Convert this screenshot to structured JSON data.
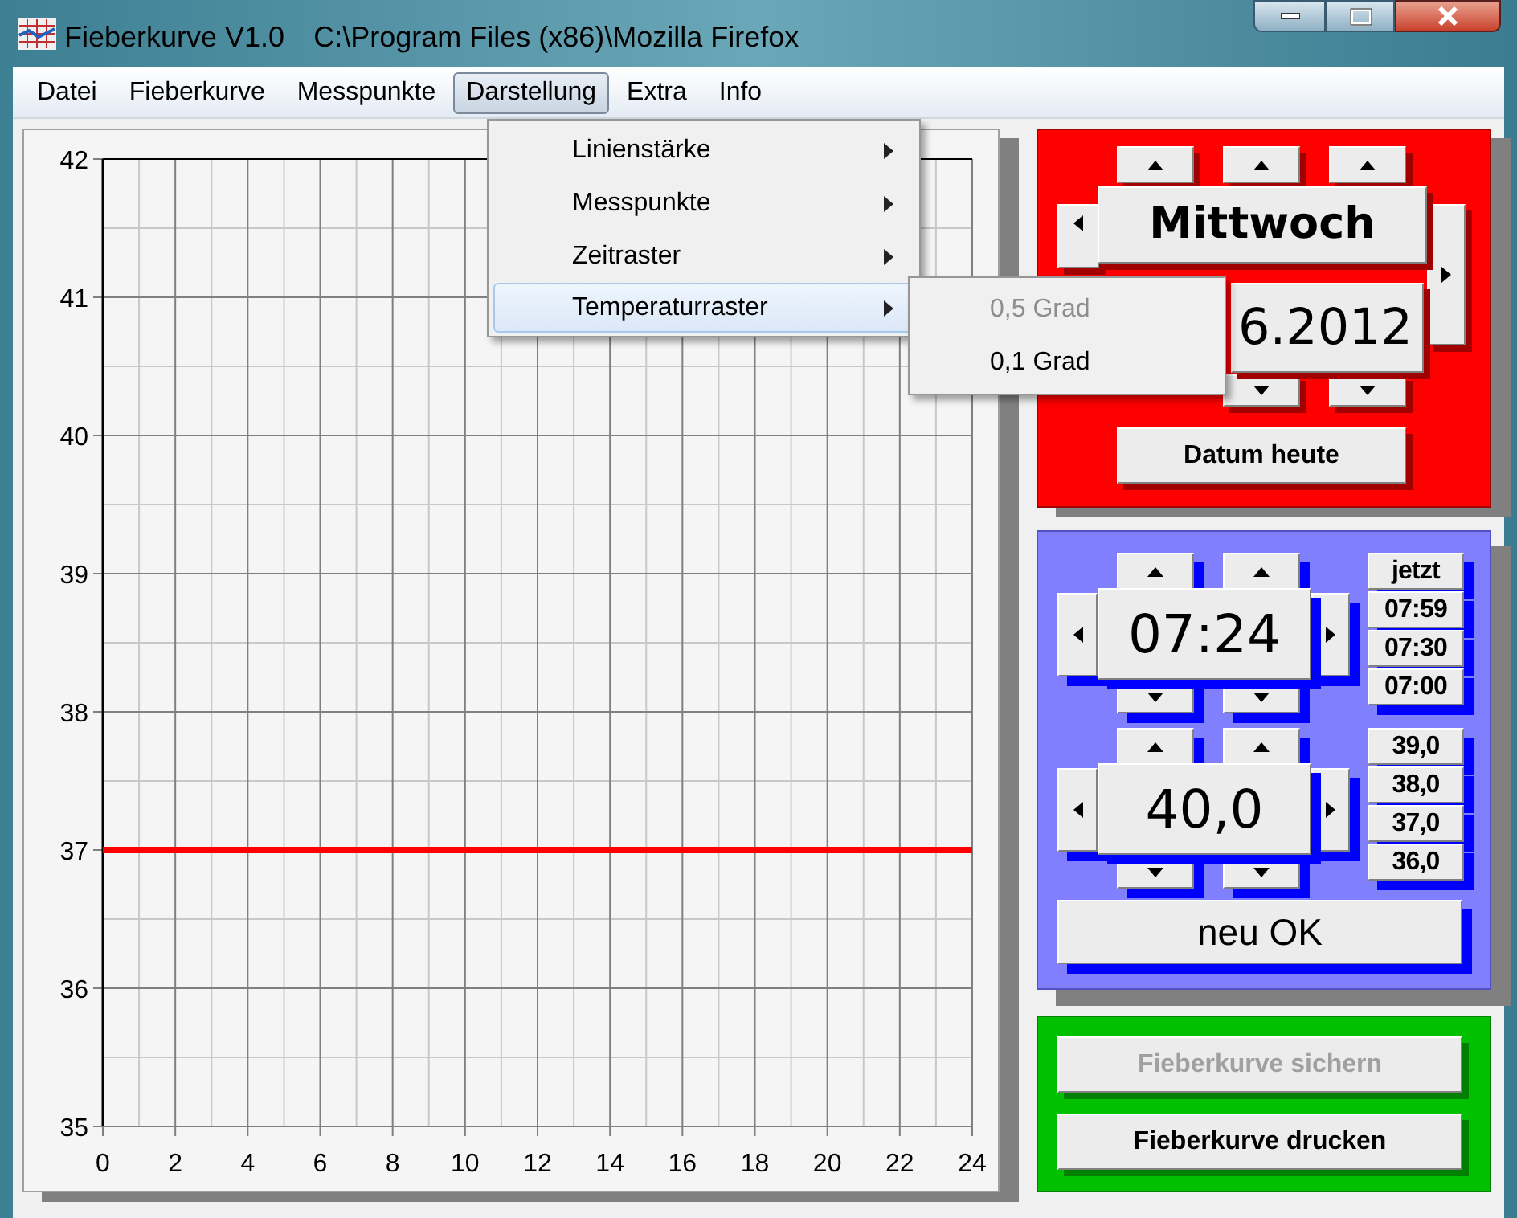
{
  "window": {
    "title": "Fieberkurve V1.0",
    "path": "C:\\Program Files (x86)\\Mozilla Firefox"
  },
  "menu": [
    {
      "label": "Datei",
      "selected": false
    },
    {
      "label": "Fieberkurve",
      "selected": false
    },
    {
      "label": "Messpunkte",
      "selected": false
    },
    {
      "label": "Darstellung",
      "selected": true
    },
    {
      "label": "Extra",
      "selected": false
    },
    {
      "label": "Info",
      "selected": false
    }
  ],
  "dropdown": [
    {
      "label": "Linienstärke",
      "selected": false
    },
    {
      "label": "Messpunkte",
      "selected": false
    },
    {
      "label": "Zeitraster",
      "selected": false
    },
    {
      "label": "Temperaturraster",
      "selected": true
    }
  ],
  "submenu": [
    {
      "label": "0,5 Grad",
      "disabled": true
    },
    {
      "label": "0,1 Grad",
      "disabled": false
    }
  ],
  "chart": {
    "chart_data": {
      "type": "line",
      "grid": true,
      "x": [
        0,
        24
      ],
      "xlim": [
        0,
        24
      ],
      "ylim": [
        35,
        42
      ],
      "xticks": [
        0,
        2,
        4,
        6,
        8,
        10,
        12,
        14,
        16,
        18,
        20,
        22,
        24
      ],
      "yticks": [
        35,
        36,
        37,
        38,
        39,
        40,
        41,
        42
      ],
      "series": [
        {
          "color": "#ff0000",
          "values": [
            37,
            37
          ]
        }
      ]
    }
  },
  "date_panel": {
    "weekday": "Mittwoch",
    "date": "6.2012",
    "today_button": "Datum heute"
  },
  "time": {
    "value": "07:24",
    "presets": [
      "jetzt",
      "07:59",
      "07:30",
      "07:00"
    ]
  },
  "temperature": {
    "value": "40,0",
    "presets": [
      "39,0",
      "38,0",
      "37,0",
      "36,0"
    ]
  },
  "confirm_button": "neu OK",
  "actions": [
    {
      "label": "Fieberkurve sichern",
      "disabled": true
    },
    {
      "label": "Fieberkurve drucken",
      "disabled": false
    }
  ]
}
